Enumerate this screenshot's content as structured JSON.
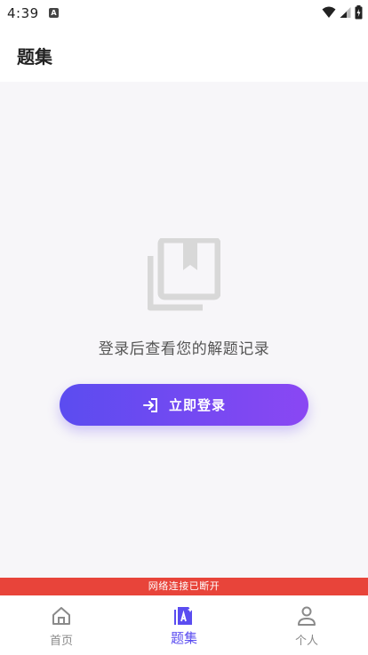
{
  "status_bar": {
    "time": "4:39",
    "app_icon_letter": "A"
  },
  "header": {
    "title": "题集"
  },
  "empty_state": {
    "icon": "library-books-icon",
    "message": "登录后查看您的解题记录"
  },
  "login_button": {
    "label": "立即登录",
    "icon": "login-icon"
  },
  "network_banner": {
    "text": "网络连接已断开"
  },
  "tabs": [
    {
      "label": "首页",
      "icon": "home-icon",
      "active": false
    },
    {
      "label": "题集",
      "icon": "question-set-icon",
      "active": true
    },
    {
      "label": "个人",
      "icon": "person-icon",
      "active": false
    }
  ],
  "colors": {
    "accent_start": "#5b4cf0",
    "accent_end": "#8a47f3",
    "banner": "#e8443a",
    "active_tab": "#5a4cf0"
  }
}
